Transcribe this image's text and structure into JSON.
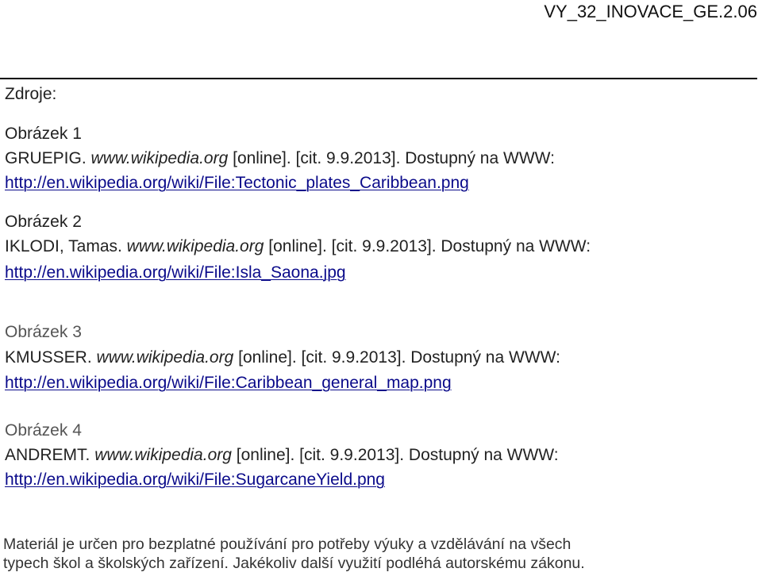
{
  "header": {
    "doc_code": "VY_32_INOVACE_GE.2.06"
  },
  "sources": {
    "title": "Zdroje:",
    "items": [
      {
        "label": "Obrázek 1",
        "author": "GRUEPIG. ",
        "site": "www.wikipedia.org",
        "citation": " [online]. [cit. 9.9.2013]. Dostupný na WWW:",
        "url": "http://en.wikipedia.org/wiki/File:Tectonic_plates_Caribbean.png"
      },
      {
        "label": "Obrázek 2",
        "author": "IKLODI, Tamas. ",
        "site": "www.wikipedia.org",
        "citation": " [online]. [cit. 9.9.2013]. Dostupný na WWW:",
        "url": "http://en.wikipedia.org/wiki/File:Isla_Saona.jpg"
      },
      {
        "label": "Obrázek 3",
        "author": "KMUSSER. ",
        "site": "www.wikipedia.org",
        "citation": " [online]. [cit. 9.9.2013]. Dostupný na WWW:",
        "url": "http://en.wikipedia.org/wiki/File:Caribbean_general_map.png"
      },
      {
        "label": "Obrázek 4",
        "author": "ANDREMT. ",
        "site": "www.wikipedia.org",
        "citation": " [online]. [cit. 9.9.2013]. Dostupný na WWW:",
        "url": "http://en.wikipedia.org/wiki/File:SugarcaneYield.png"
      }
    ]
  },
  "footer": {
    "line1": "Materiál je určen pro bezplatné používání pro potřeby výuky a vzdělávání na všech",
    "line2": "typech škol a školských zařízení. Jakékoliv další využití podléhá autorskému zákonu."
  }
}
